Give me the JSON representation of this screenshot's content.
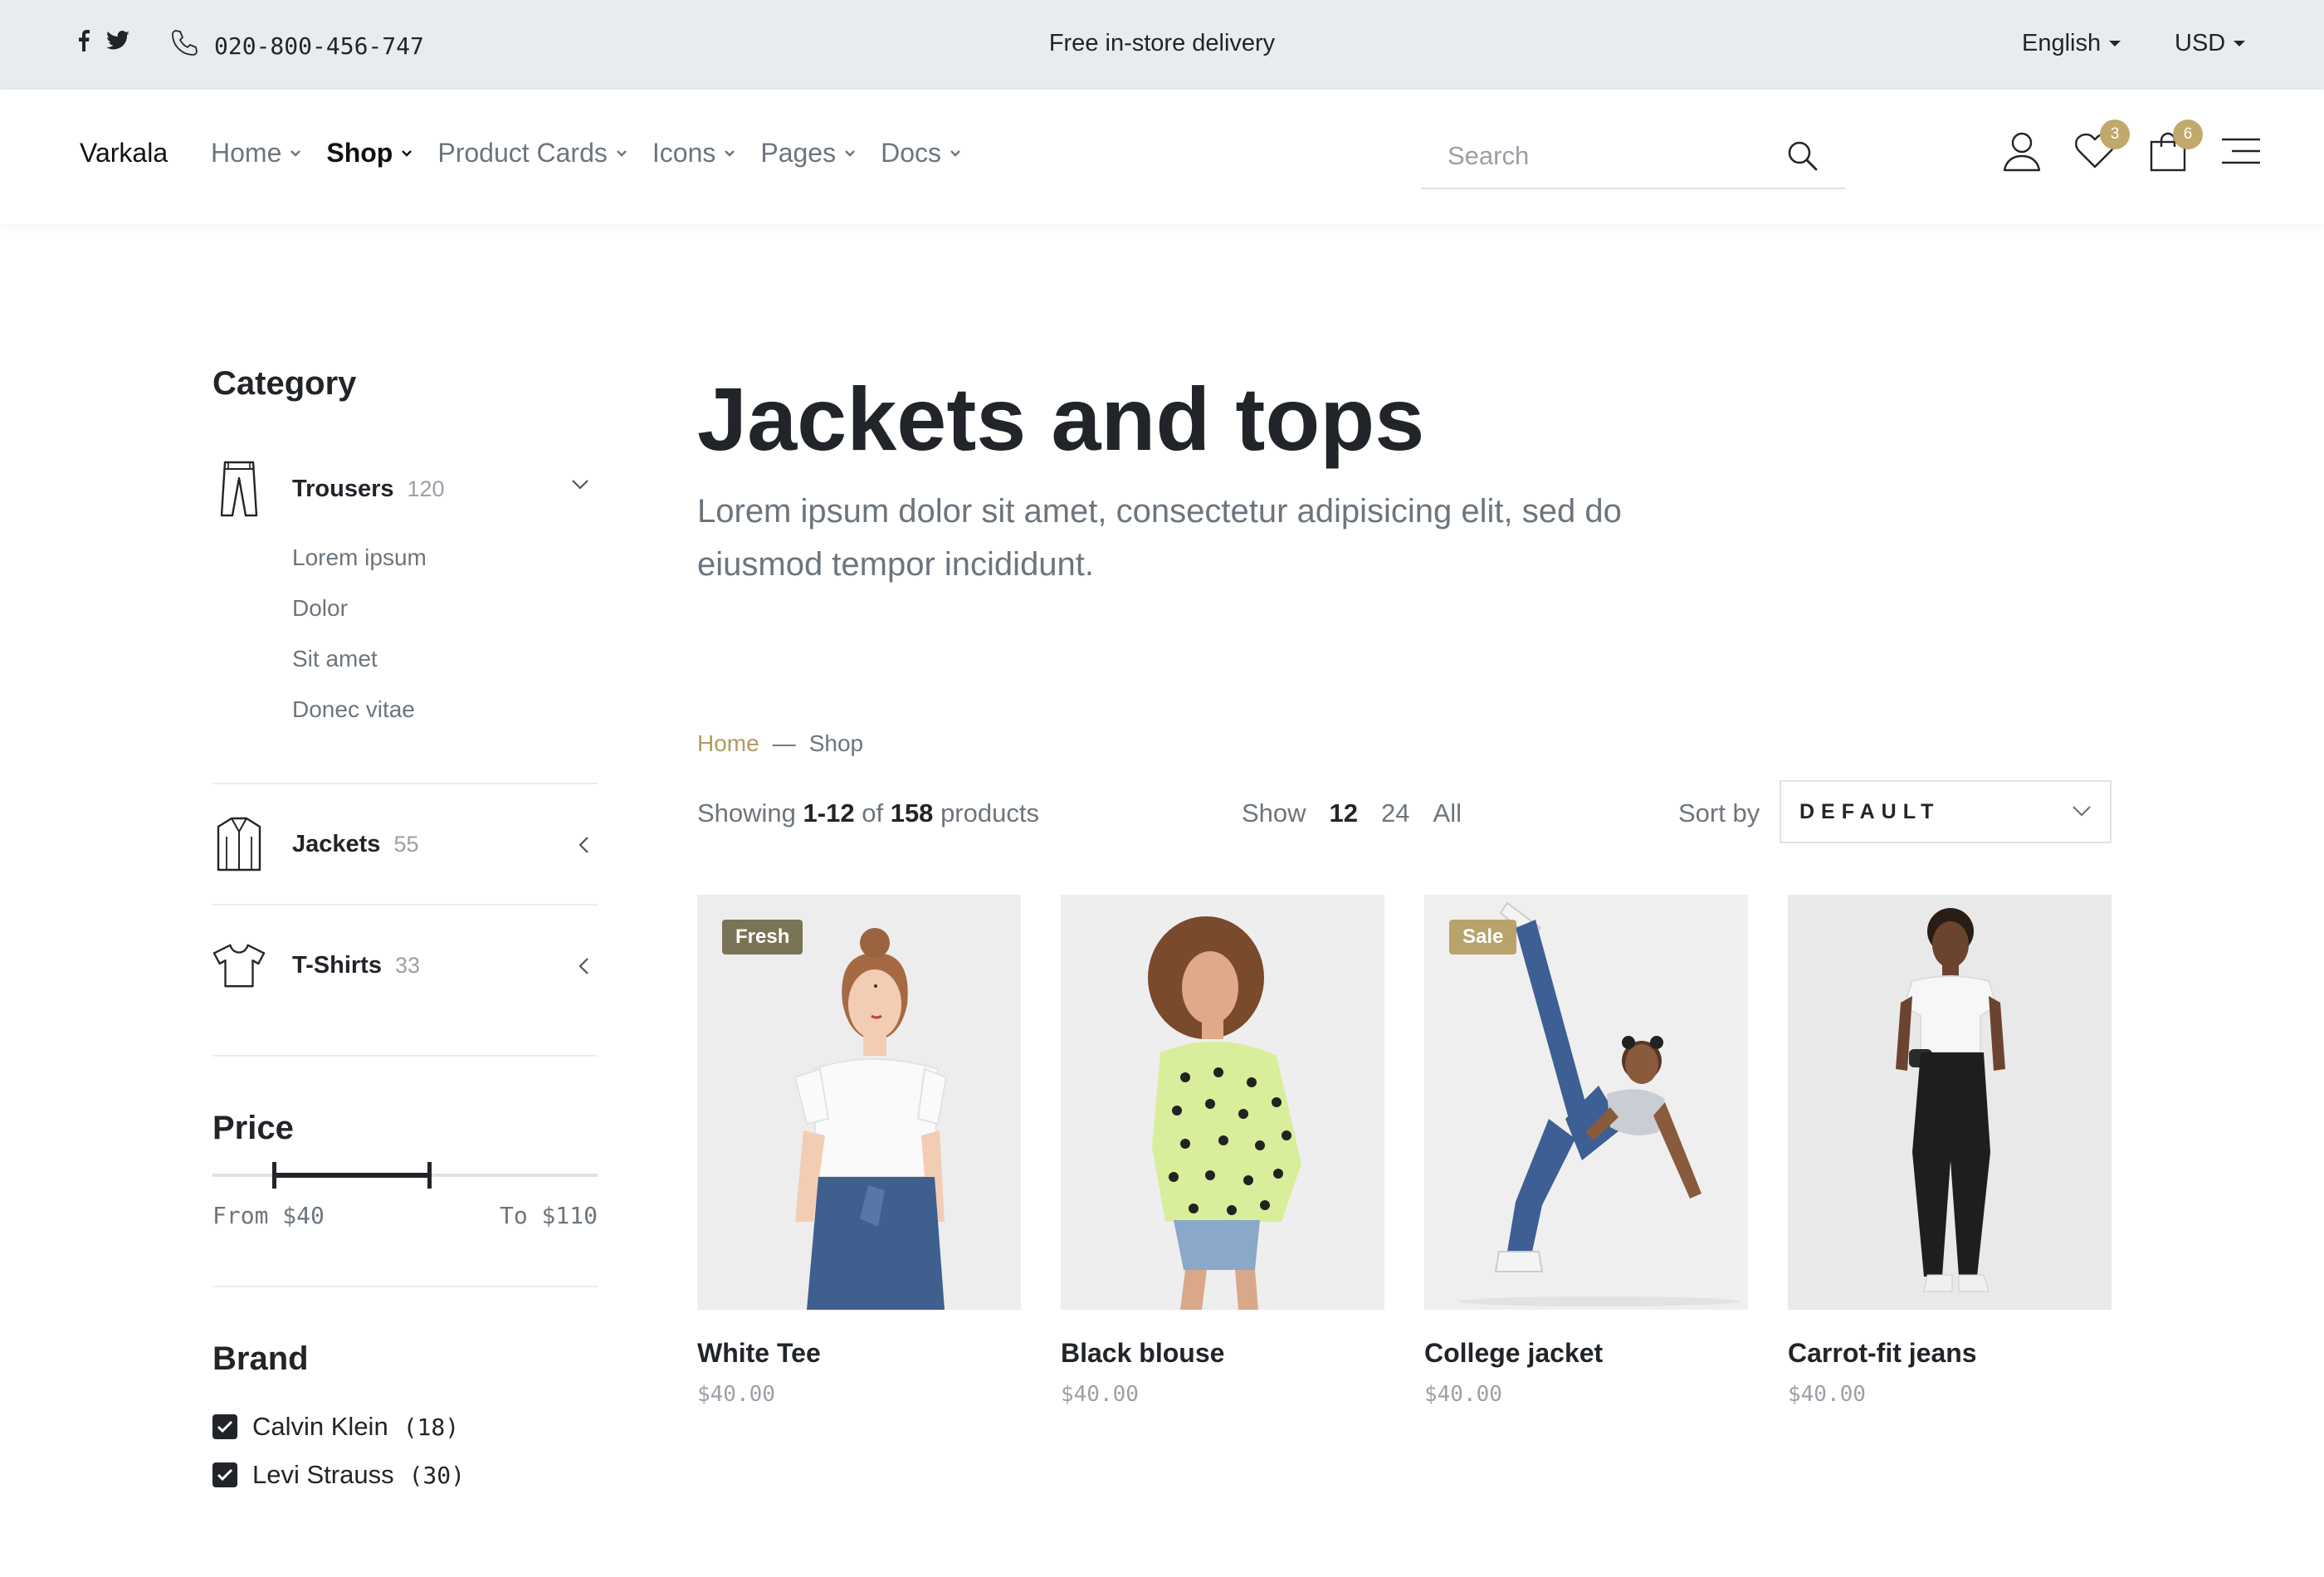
{
  "topbar": {
    "social_icons": [
      "facebook-icon",
      "twitter-icon"
    ],
    "phone": "020-800-456-747",
    "delivery": "Free in-store delivery",
    "language": "English",
    "currency": "USD"
  },
  "header": {
    "brand": "Varkala",
    "nav": [
      {
        "label": "Home",
        "active": false
      },
      {
        "label": "Shop",
        "active": true
      },
      {
        "label": "Product Cards",
        "active": false
      },
      {
        "label": "Icons",
        "active": false
      },
      {
        "label": "Pages",
        "active": false
      },
      {
        "label": "Docs",
        "active": false
      }
    ],
    "search_placeholder": "Search",
    "wishlist_count": "3",
    "cart_count": "6"
  },
  "sidebar": {
    "category_heading": "Category",
    "categories": [
      {
        "name": "Trousers",
        "count": "120",
        "icon": "trousers-icon",
        "expanded": true,
        "subs": [
          "Lorem ipsum",
          "Dolor",
          "Sit amet",
          "Donec vitae"
        ]
      },
      {
        "name": "Jackets",
        "count": "55",
        "icon": "jacket-icon",
        "expanded": false
      },
      {
        "name": "T-Shirts",
        "count": "33",
        "icon": "tshirt-icon",
        "expanded": false
      }
    ],
    "price_heading": "Price",
    "price": {
      "from": "From $40",
      "to": "To $110",
      "min": 40,
      "max": 110
    },
    "brand_heading": "Brand",
    "brands": [
      {
        "name": "Calvin Klein",
        "count": "(18)",
        "checked": true
      },
      {
        "name": "Levi Strauss",
        "count": "(30)",
        "checked": true
      }
    ]
  },
  "main": {
    "title": "Jackets and tops",
    "lead": "Lorem ipsum dolor sit amet, consectetur adipisicing elit, sed do eiusmod tempor incididunt.",
    "breadcrumb": {
      "home": "Home",
      "sep": "—",
      "current": "Shop"
    },
    "showing": {
      "prefix": "Showing",
      "range": "1-12",
      "of": "of",
      "total": "158",
      "suffix": "products"
    },
    "show": {
      "label": "Show",
      "options": [
        "12",
        "24",
        "All"
      ],
      "active": "12"
    },
    "sort": {
      "label": "Sort by",
      "value": "DEFAULT"
    },
    "products": [
      {
        "name": "White Tee",
        "price": "$40.00",
        "tag": "Fresh",
        "tag_color": "#7a7356"
      },
      {
        "name": "Black blouse",
        "price": "$40.00",
        "tag": "",
        "tag_color": ""
      },
      {
        "name": "College jacket",
        "price": "$40.00",
        "tag": "Sale",
        "tag_color": "#b8a36b"
      },
      {
        "name": "Carrot-fit jeans",
        "price": "$40.00",
        "tag": "",
        "tag_color": ""
      }
    ]
  },
  "colors": {
    "accent": "#c1a86b",
    "breadcrumb_link": "#b29a5f",
    "muted": "#6c757d",
    "dark": "#212529"
  }
}
